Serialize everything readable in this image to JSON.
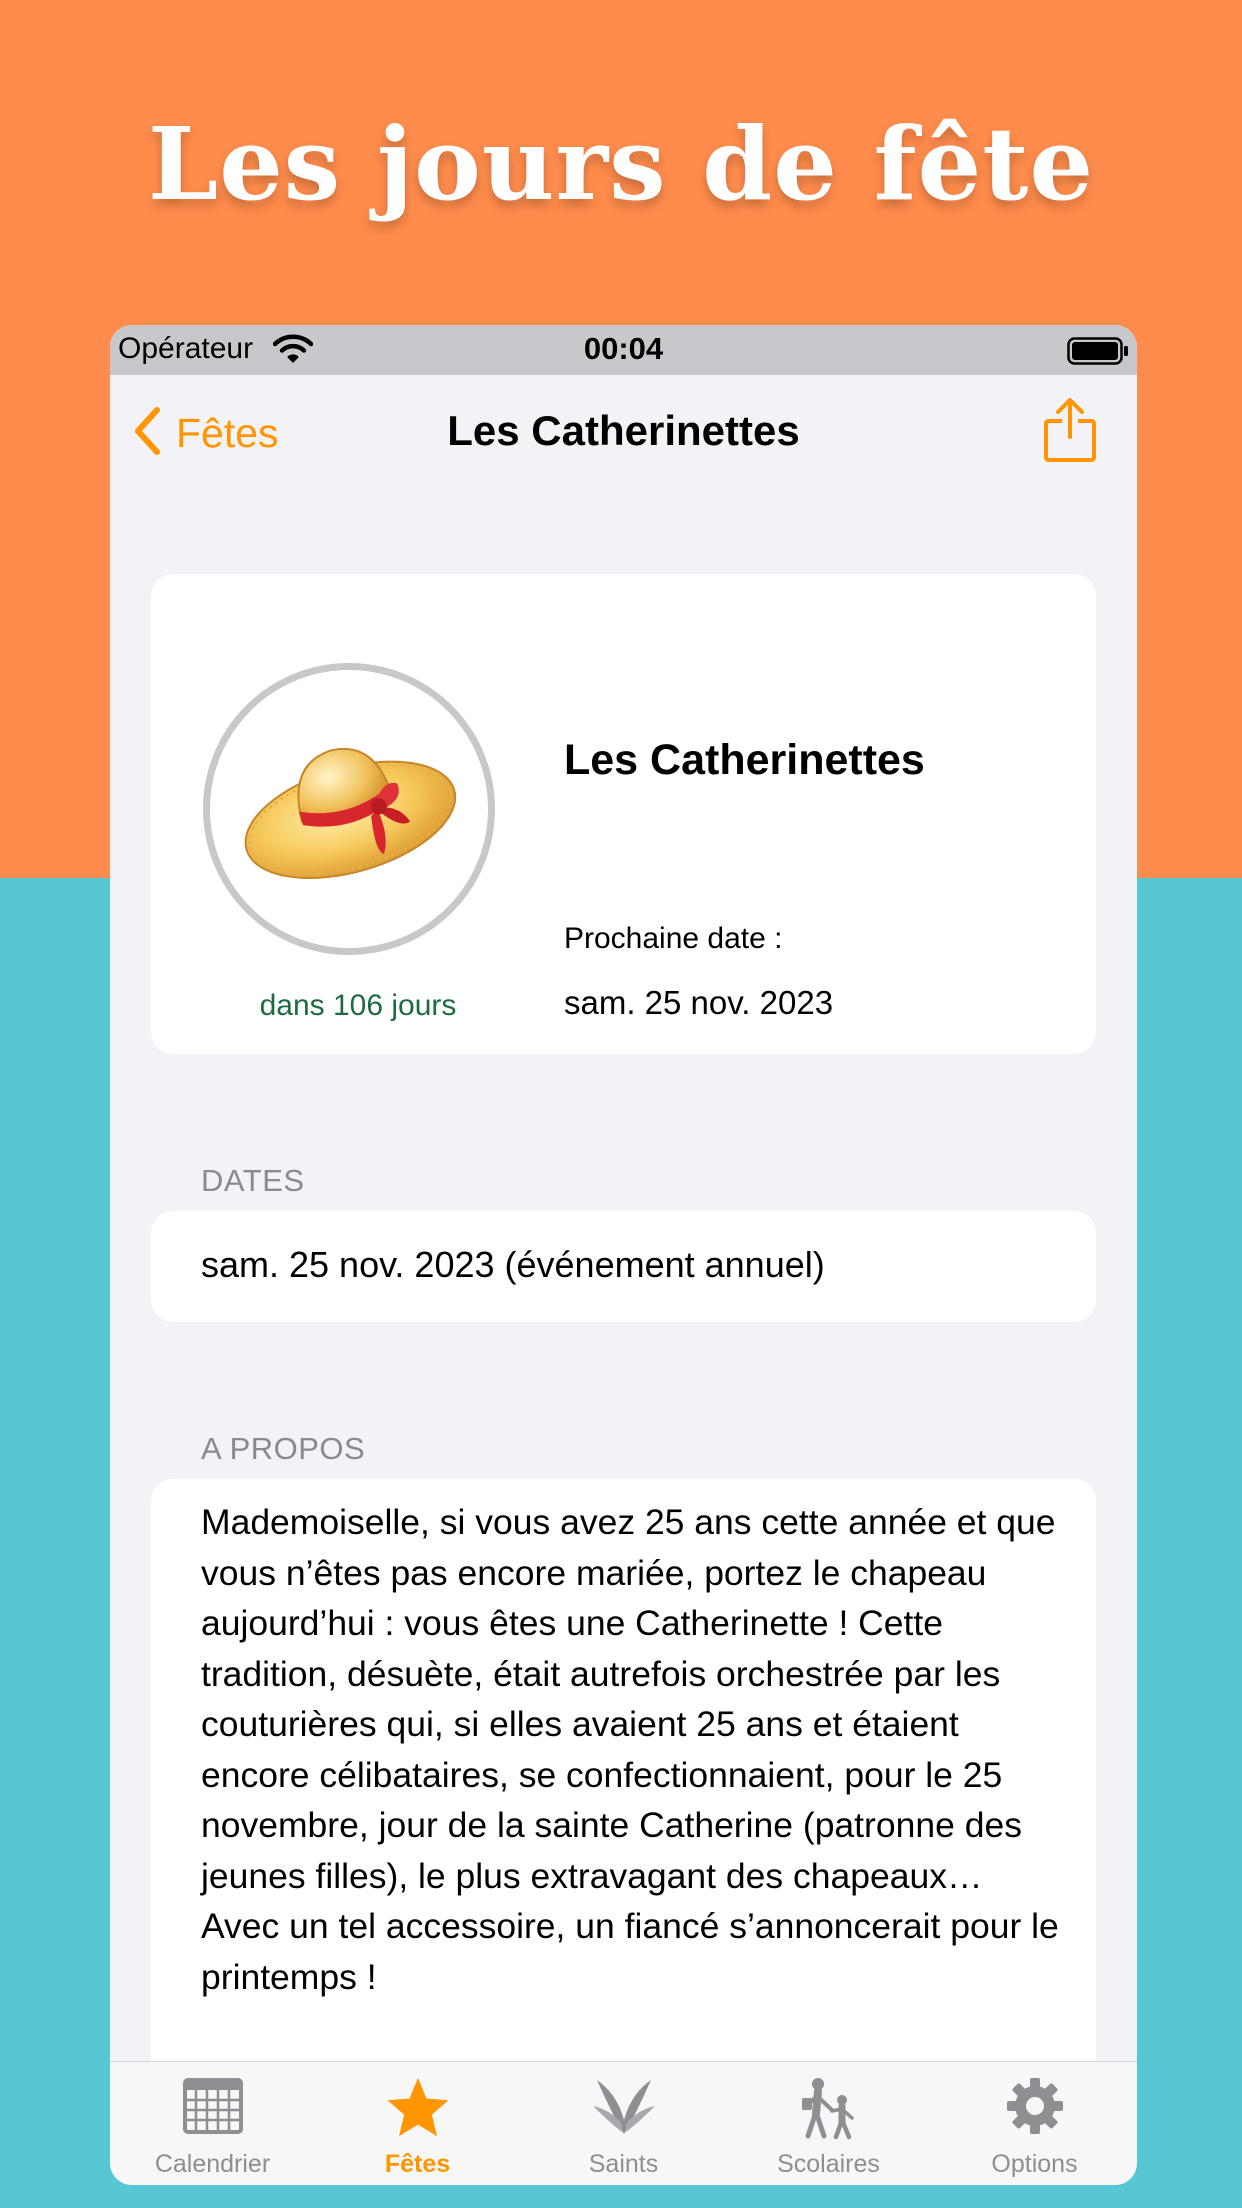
{
  "promo": {
    "title": "Les jours de fête"
  },
  "status_bar": {
    "carrier": "Opérateur",
    "time": "00:04"
  },
  "nav": {
    "back_label": "Fêtes",
    "title": "Les Catherinettes"
  },
  "header_card": {
    "name": "Les Catherinettes",
    "days_left": "dans 106 jours",
    "next_date_label": "Prochaine date :",
    "next_date": "sam. 25 nov. 2023"
  },
  "dates_section": {
    "header": "DATES",
    "items": [
      "sam. 25 nov. 2023 (événement annuel)"
    ]
  },
  "about_section": {
    "header": "A PROPOS",
    "text": "Mademoiselle, si vous avez 25 ans cette année et que vous n’êtes pas encore mariée, portez le chapeau aujourd’hui : vous êtes une Catherinette ! Cette tradition, désuète, était autrefois orchestrée par les couturières qui, si elles avaient 25 ans et étaient encore célibataires, se confectionnaient, pour le 25 novembre, jour de la sainte Catherine (patronne des jeunes filles), le plus extravagant des chapeaux… Avec un tel accessoire, un fiancé s’annoncerait pour le printemps !"
  },
  "tabs": [
    {
      "label": "Calendrier",
      "icon": "calendar-icon",
      "active": false
    },
    {
      "label": "Fêtes",
      "icon": "star-icon",
      "active": true
    },
    {
      "label": "Saints",
      "icon": "saint-wings-icon",
      "active": false
    },
    {
      "label": "Scolaires",
      "icon": "school-children-icon",
      "active": false
    },
    {
      "label": "Options",
      "icon": "gear-icon",
      "active": false
    }
  ],
  "colors": {
    "accent": "#ff9500",
    "promo_top": "#ff8c4c",
    "promo_bottom": "#57c7d4",
    "days_left": "#1d6b3f"
  }
}
